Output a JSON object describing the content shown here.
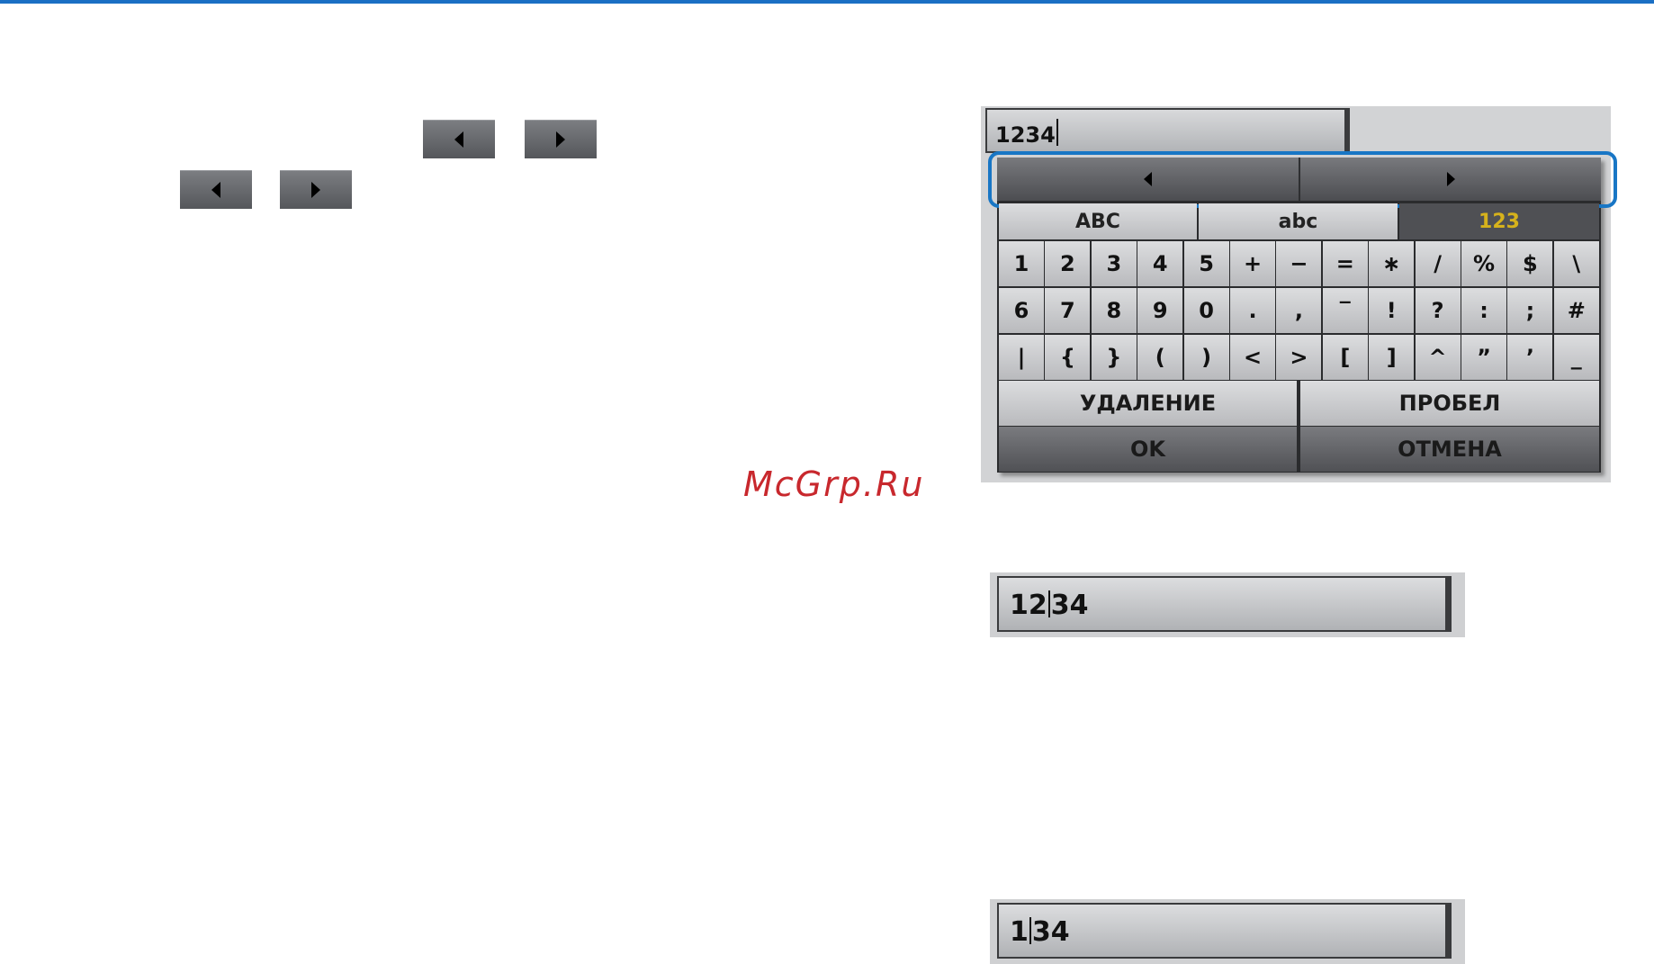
{
  "watermark": "McGrp.Ru",
  "icons": {
    "left": "triangle-left-icon",
    "right": "triangle-right-icon"
  },
  "keyboard": {
    "input_value": "1234",
    "tabs": [
      {
        "label": "ABC",
        "active": false
      },
      {
        "label": "abc",
        "active": false
      },
      {
        "label": "123",
        "active": true
      }
    ],
    "rows": [
      [
        "1",
        "2",
        "3",
        "4",
        "5",
        "+",
        "−",
        "=",
        "∗",
        "/",
        "%",
        "$",
        "\\"
      ],
      [
        "6",
        "7",
        "8",
        "9",
        "0",
        ".",
        ",",
        "‾",
        "!",
        "?",
        ":",
        ";",
        "#"
      ],
      [
        "|",
        "{",
        "}",
        "(",
        ")",
        "<",
        ">",
        "[",
        "]",
        "^",
        "”",
        "’",
        "_"
      ]
    ],
    "delete_label": "УДАЛЕНИЕ",
    "space_label": "ПРОБЕЛ",
    "ok_label": "OK",
    "cancel_label": "ОТМЕНА"
  },
  "field2": {
    "before": "12",
    "after": "34"
  },
  "field3": {
    "before": "1",
    "after": "34"
  },
  "colors": {
    "highlight": "#1876c5",
    "active_tab_text": "#d6b21c",
    "watermark": "#c8282d",
    "top_rule": "#1a6fc4"
  }
}
